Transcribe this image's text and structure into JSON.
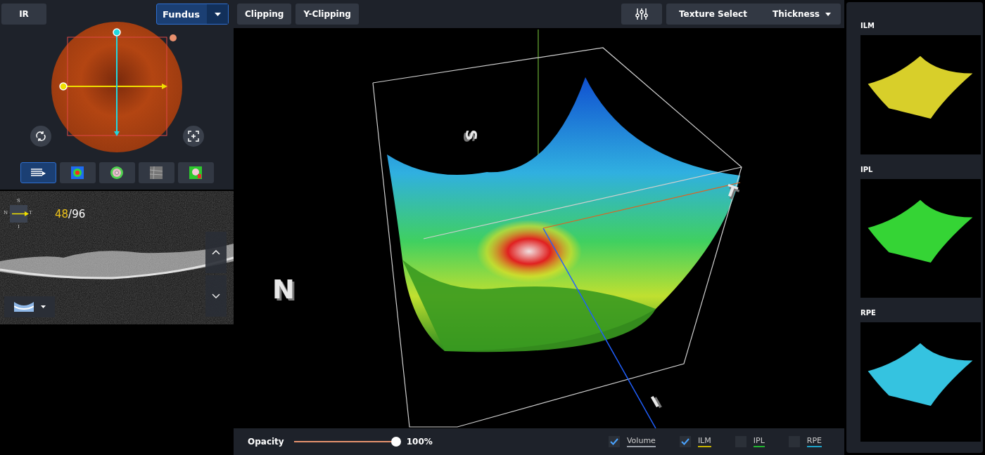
{
  "left_panel": {
    "source_button": "IR",
    "image_dropdown": {
      "value": "Fundus"
    },
    "view_modes": [
      {
        "kind": "lines",
        "selected": true
      },
      {
        "kind": "thickness",
        "selected": false
      },
      {
        "kind": "sectors",
        "selected": false
      },
      {
        "kind": "texture",
        "selected": false
      },
      {
        "kind": "deviation",
        "selected": false
      }
    ]
  },
  "bscan": {
    "orientation": {
      "top": "S",
      "left": "N",
      "right": "T",
      "bottom": "I"
    },
    "slice": {
      "current": "48",
      "total": "/96"
    }
  },
  "toolbar": {
    "buttons": [
      "Clipping",
      "Y-Clipping"
    ],
    "texture_select": {
      "label": "Texture Select",
      "value": "Thickness"
    }
  },
  "view_labels": [
    {
      "text": "S"
    },
    {
      "text": "N"
    },
    {
      "text": "T"
    },
    {
      "text": "I"
    }
  ],
  "bottom_bar": {
    "opacity": {
      "label": "Opacity",
      "level": 1.0,
      "reading": "100%"
    },
    "layers": [
      {
        "label": "Volume",
        "checked": true,
        "color": "#9aa0a8"
      },
      {
        "label": "ILM",
        "checked": true,
        "color": "#c8b400"
      },
      {
        "label": "IPL",
        "checked": false,
        "color": "#22b530"
      },
      {
        "label": "RPE",
        "checked": false,
        "color": "#1ea3c8"
      }
    ]
  },
  "previews": [
    {
      "title": "ILM",
      "color": "#d8cf2a"
    },
    {
      "title": "IPL",
      "color": "#35d435"
    },
    {
      "title": "RPE",
      "color": "#35c3e0"
    }
  ]
}
